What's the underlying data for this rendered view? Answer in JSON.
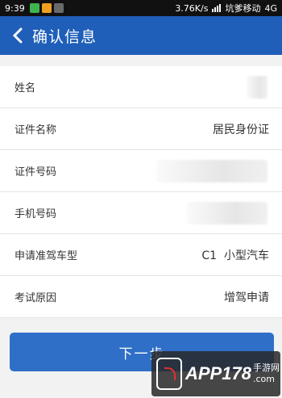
{
  "status_bar": {
    "time": "9:39",
    "speed": "3.76K/s",
    "carrier": "坑爹移动",
    "network": "4G"
  },
  "app_bar": {
    "title": "确认信息"
  },
  "rows": [
    {
      "label": "姓名",
      "value": ""
    },
    {
      "label": "证件名称",
      "value": "居民身份证"
    },
    {
      "label": "证件号码",
      "value": ""
    },
    {
      "label": "手机号码",
      "value": ""
    },
    {
      "label": "申请准驾车型",
      "value": "C1  小型汽车"
    },
    {
      "label": "考试原因",
      "value": "增驾申请"
    }
  ],
  "next_button": {
    "label": "下一步"
  },
  "watermark": {
    "brand": "APP178",
    "sub1": "手游网",
    "sub2": ".com"
  },
  "colors": {
    "app_bar": "#1f5fb9",
    "button": "#2f6fc8"
  }
}
